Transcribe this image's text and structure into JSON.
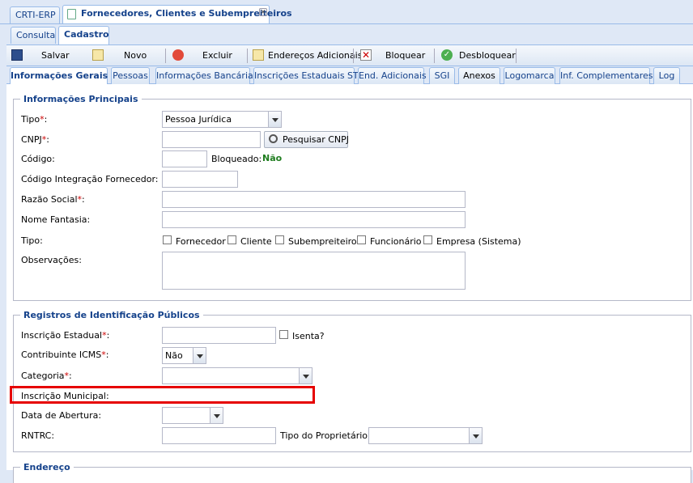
{
  "top_tabs": [
    {
      "label": "CRTI-ERP"
    },
    {
      "label": "Fornecedores, Clientes e Subempreiteiros"
    }
  ],
  "sub_tabs": [
    {
      "label": "Consulta"
    },
    {
      "label": "Cadastro"
    }
  ],
  "toolbar": {
    "save": "Salvar",
    "new": "Novo",
    "delete": "Excluir",
    "addresses": "Endereços Adicionais",
    "block": "Bloquear",
    "unblock": "Desbloquear"
  },
  "form_tabs": [
    "Informações Gerais",
    "Pessoas",
    "Informações Bancárias",
    "Inscrições Estaduais ST",
    "End. Adicionais",
    "SGI",
    "Anexos",
    "Logomarca",
    "Inf. Complementares",
    "Log"
  ],
  "principal": {
    "legend": "Informações Principais",
    "tipo_label": "Tipo",
    "tipo_value": "Pessoa Jurídica",
    "cnpj_label": "CNPJ",
    "cnpj_button": "Pesquisar CNPJ",
    "codigo_label": "Código:",
    "bloqueado_label": "Bloqueado:",
    "bloqueado_value": "Não",
    "cod_integracao_label": "Código Integração Fornecedor:",
    "razao_label": "Razão Social",
    "fantasia_label": "Nome Fantasia:",
    "tipo2_label": "Tipo:",
    "tipo_options": [
      "Fornecedor",
      "Cliente",
      "Subempreiteiro",
      "Funcionário",
      "Empresa (Sistema)"
    ],
    "obs_label": "Observações:"
  },
  "registros": {
    "legend": "Registros de Identificação Públicos",
    "ie_label": "Inscrição Estadual",
    "isenta_label": "Isenta?",
    "icms_label": "Contribuinte ICMS",
    "icms_value": "Não",
    "categoria_label": "Categoria",
    "im_label": "Inscrição Municipal:",
    "abertura_label": "Data de Abertura:",
    "rntrc_label": "RNTRC:",
    "tipo_prop_label": "Tipo do Proprietário:"
  },
  "endereco": {
    "legend": "Endereço"
  },
  "colors": {
    "highlight": "#e60000",
    "accent": "#15428b",
    "status_ok": "#1f7d1f"
  }
}
